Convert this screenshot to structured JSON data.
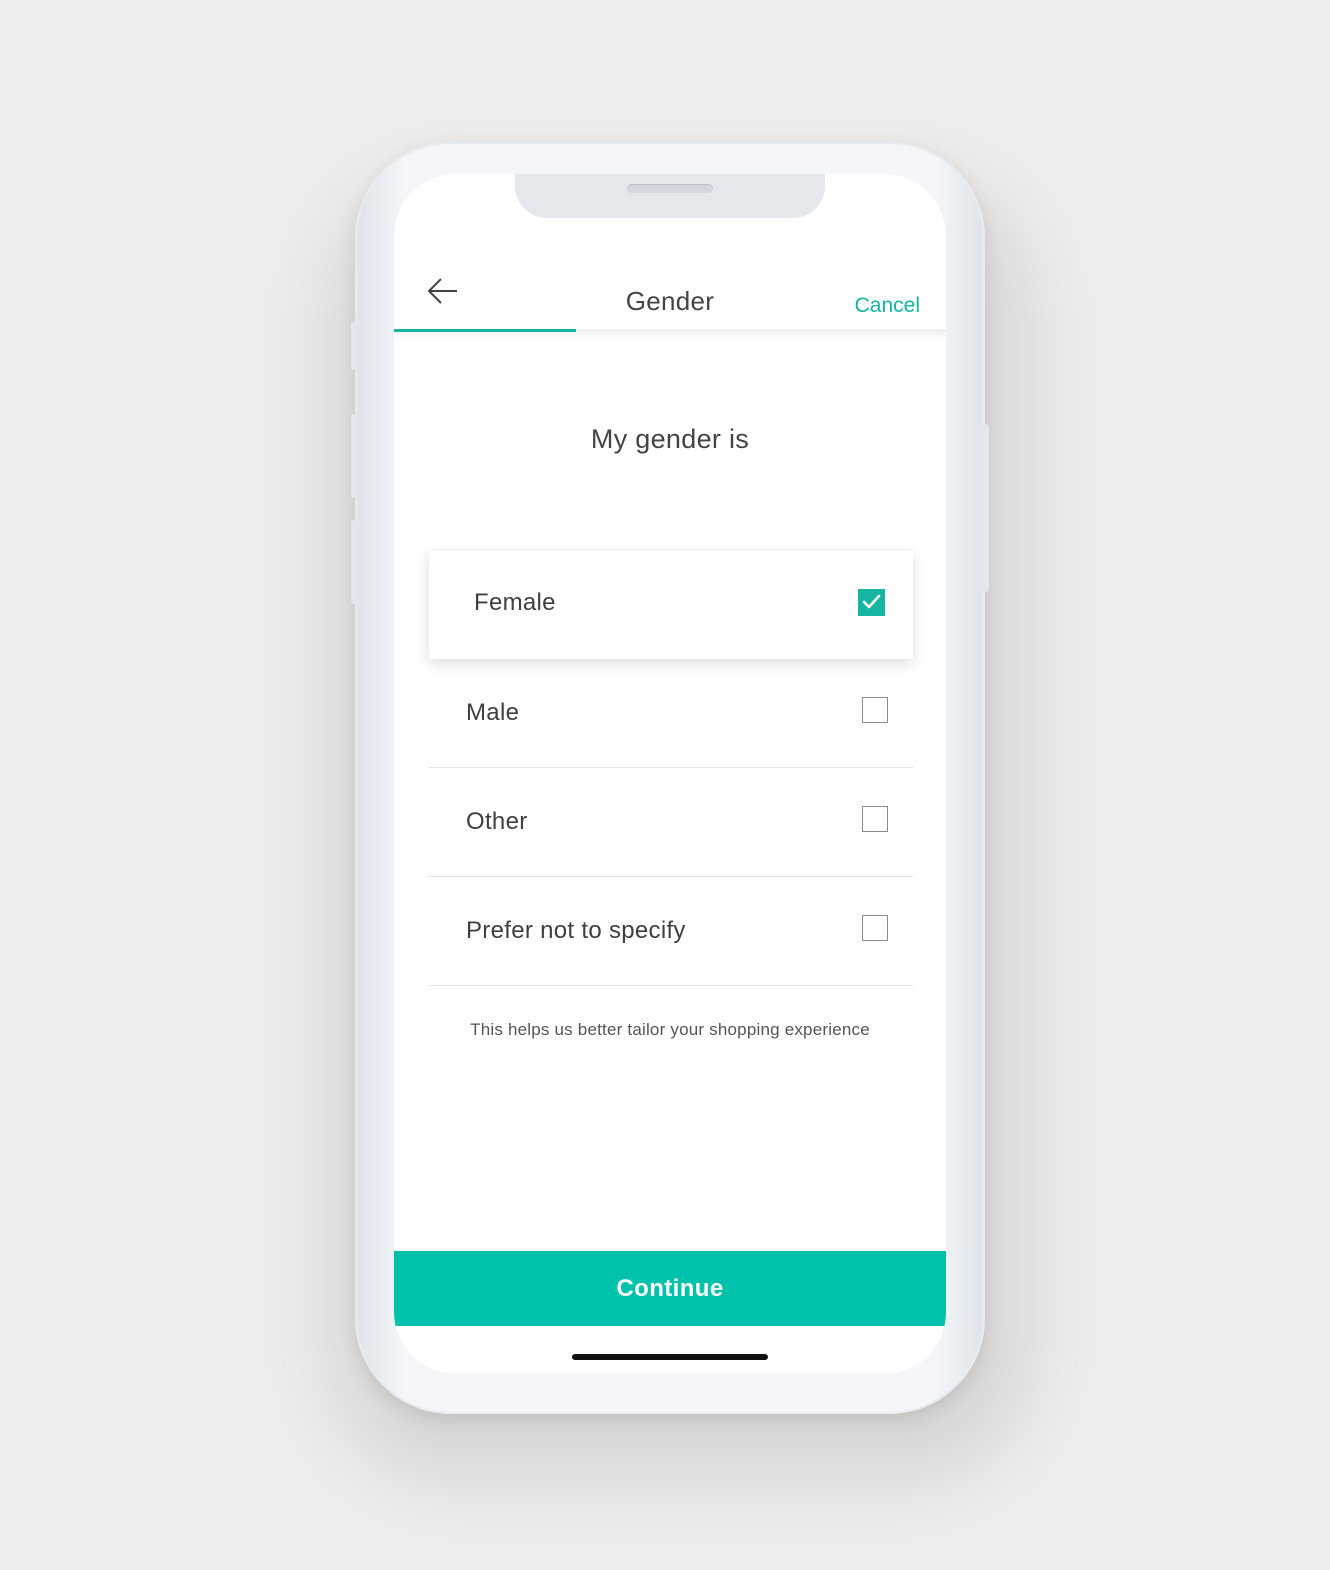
{
  "header": {
    "title": "Gender",
    "cancel_label": "Cancel",
    "back_icon": "arrow-left-icon",
    "progress": 0.33
  },
  "question": "My gender is",
  "options": [
    {
      "label": "Female",
      "checked": true
    },
    {
      "label": "Male",
      "checked": false
    },
    {
      "label": "Other",
      "checked": false
    },
    {
      "label": "Prefer not to specify",
      "checked": false
    }
  ],
  "hint": "This helps us better tailor your shopping experience",
  "continue_label": "Continue",
  "colors": {
    "accent": "#15b5a2",
    "button": "#00c2ac",
    "background": "#efeeec"
  }
}
